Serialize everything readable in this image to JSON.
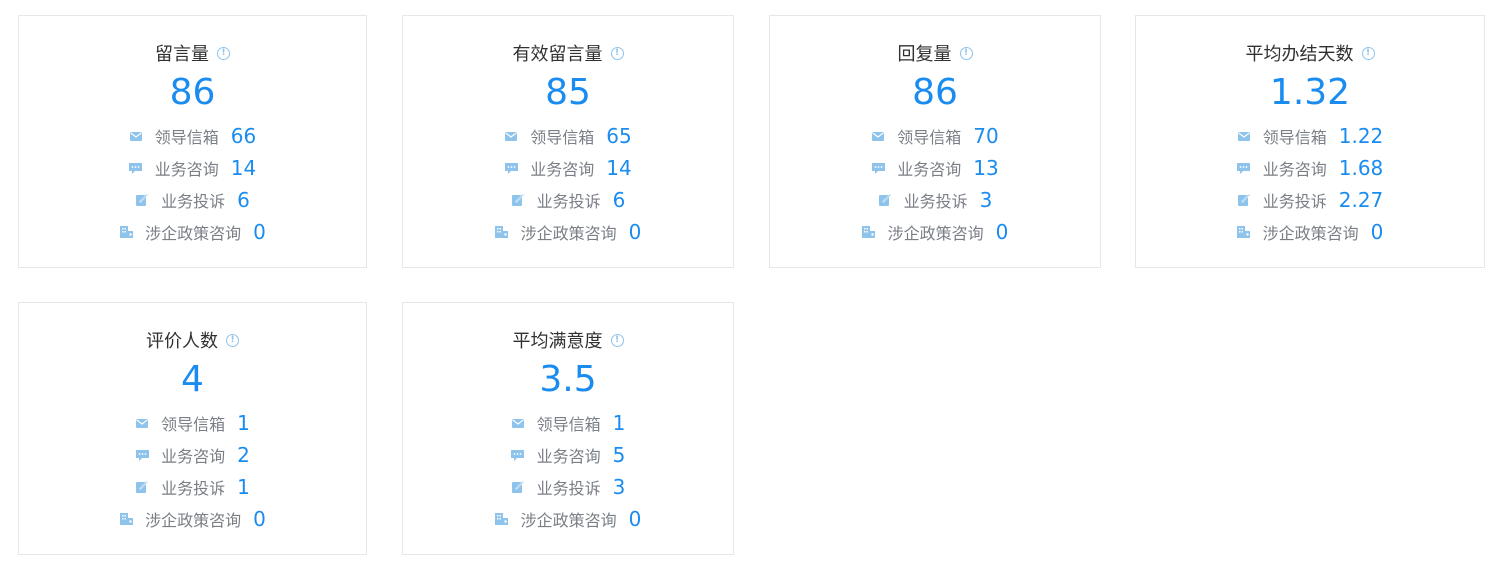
{
  "cards": [
    {
      "title": "留言量",
      "value": "86",
      "rows": [
        {
          "label": "领导信箱",
          "value": "66",
          "icon": "mail-icon"
        },
        {
          "label": "业务咨询",
          "value": "14",
          "icon": "chat-icon"
        },
        {
          "label": "业务投诉",
          "value": "6",
          "icon": "edit-icon"
        },
        {
          "label": "涉企政策咨询",
          "value": "0",
          "icon": "building-icon"
        }
      ]
    },
    {
      "title": "有效留言量",
      "value": "85",
      "rows": [
        {
          "label": "领导信箱",
          "value": "65",
          "icon": "mail-icon"
        },
        {
          "label": "业务咨询",
          "value": "14",
          "icon": "chat-icon"
        },
        {
          "label": "业务投诉",
          "value": "6",
          "icon": "edit-icon"
        },
        {
          "label": "涉企政策咨询",
          "value": "0",
          "icon": "building-icon"
        }
      ]
    },
    {
      "title": "回复量",
      "value": "86",
      "rows": [
        {
          "label": "领导信箱",
          "value": "70",
          "icon": "mail-icon"
        },
        {
          "label": "业务咨询",
          "value": "13",
          "icon": "chat-icon"
        },
        {
          "label": "业务投诉",
          "value": "3",
          "icon": "edit-icon"
        },
        {
          "label": "涉企政策咨询",
          "value": "0",
          "icon": "building-icon"
        }
      ]
    },
    {
      "title": "平均办结天数",
      "value": "1.32",
      "rows": [
        {
          "label": "领导信箱",
          "value": "1.22",
          "icon": "mail-icon"
        },
        {
          "label": "业务咨询",
          "value": "1.68",
          "icon": "chat-icon"
        },
        {
          "label": "业务投诉",
          "value": "2.27",
          "icon": "edit-icon"
        },
        {
          "label": "涉企政策咨询",
          "value": "0",
          "icon": "building-icon"
        }
      ]
    },
    {
      "title": "评价人数",
      "value": "4",
      "rows": [
        {
          "label": "领导信箱",
          "value": "1",
          "icon": "mail-icon"
        },
        {
          "label": "业务咨询",
          "value": "2",
          "icon": "chat-icon"
        },
        {
          "label": "业务投诉",
          "value": "1",
          "icon": "edit-icon"
        },
        {
          "label": "涉企政策咨询",
          "value": "0",
          "icon": "building-icon"
        }
      ]
    },
    {
      "title": "平均满意度",
      "value": "3.5",
      "rows": [
        {
          "label": "领导信箱",
          "value": "1",
          "icon": "mail-icon"
        },
        {
          "label": "业务咨询",
          "value": "5",
          "icon": "chat-icon"
        },
        {
          "label": "业务投诉",
          "value": "3",
          "icon": "edit-icon"
        },
        {
          "label": "涉企政策咨询",
          "value": "0",
          "icon": "building-icon"
        }
      ]
    }
  ],
  "colors": {
    "accent": "#1a8cf0",
    "icon": "#8ec3ec",
    "label": "#7a7f87",
    "title": "#303133",
    "border": "#e4e7ec"
  }
}
